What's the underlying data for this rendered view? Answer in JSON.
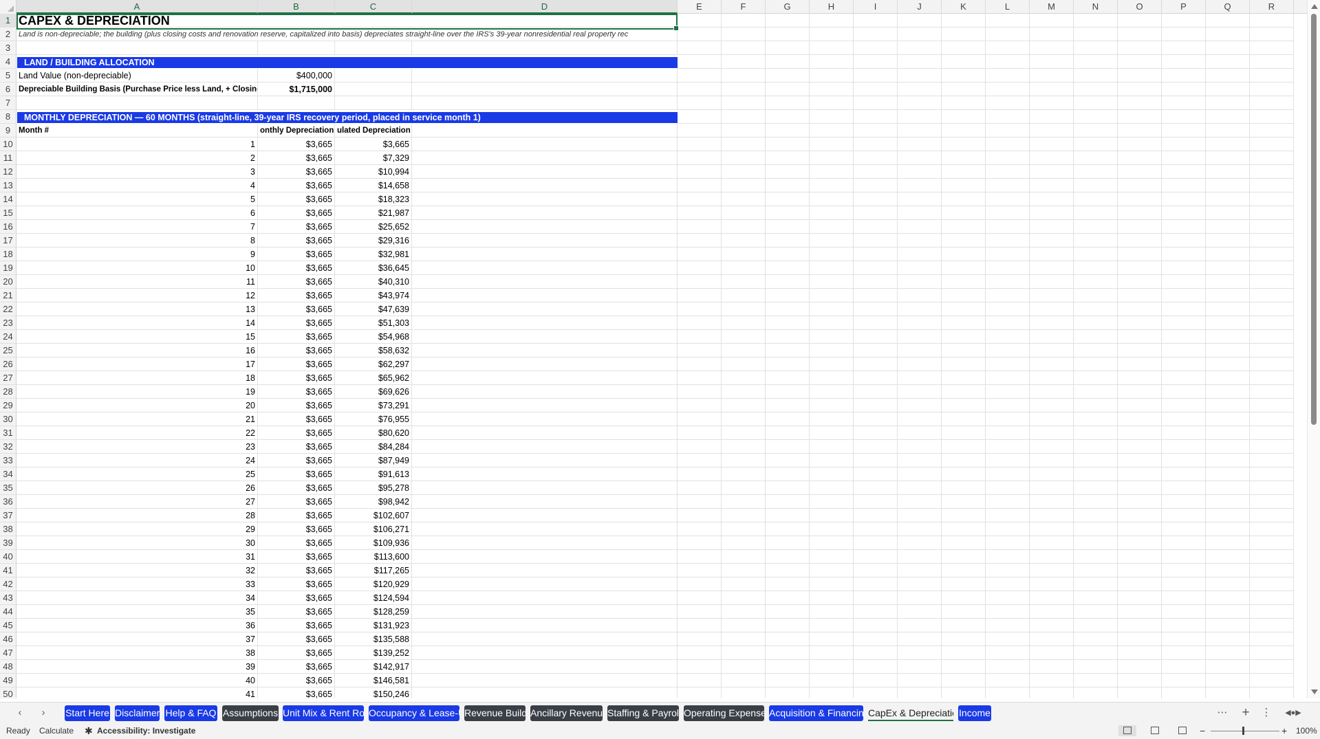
{
  "columns": [
    "A",
    "B",
    "C",
    "D",
    "E",
    "F",
    "G",
    "H",
    "I",
    "J",
    "K",
    "L",
    "M",
    "N",
    "O",
    "P",
    "Q",
    "R"
  ],
  "sheet": {
    "title": "CAPEX & DEPRECIATION",
    "note": "Land is non-depreciable; the building (plus closing costs and renovation reserve, capitalized into basis) depreciates straight-line over the IRS's 39-year nonresidential real property rec",
    "section1": "LAND / BUILDING ALLOCATION",
    "land_label": "Land Value (non-depreciable)",
    "land_value": "$400,000",
    "basis_label": "Depreciable Building Basis (Purchase Price less Land, + Closing Co",
    "basis_value": "$1,715,000",
    "section2": "MONTHLY DEPRECIATION — 60 MONTHS (straight-line, 39-year IRS recovery period, placed in service month 1)",
    "hdr_month": "Month #",
    "hdr_monthly": "onthly Depreciation",
    "hdr_accum": "ulated Depreciation"
  },
  "schedule": [
    {
      "month": "1",
      "monthly": "$3,665",
      "accum": "$3,665"
    },
    {
      "month": "2",
      "monthly": "$3,665",
      "accum": "$7,329"
    },
    {
      "month": "3",
      "monthly": "$3,665",
      "accum": "$10,994"
    },
    {
      "month": "4",
      "monthly": "$3,665",
      "accum": "$14,658"
    },
    {
      "month": "5",
      "monthly": "$3,665",
      "accum": "$18,323"
    },
    {
      "month": "6",
      "monthly": "$3,665",
      "accum": "$21,987"
    },
    {
      "month": "7",
      "monthly": "$3,665",
      "accum": "$25,652"
    },
    {
      "month": "8",
      "monthly": "$3,665",
      "accum": "$29,316"
    },
    {
      "month": "9",
      "monthly": "$3,665",
      "accum": "$32,981"
    },
    {
      "month": "10",
      "monthly": "$3,665",
      "accum": "$36,645"
    },
    {
      "month": "11",
      "monthly": "$3,665",
      "accum": "$40,310"
    },
    {
      "month": "12",
      "monthly": "$3,665",
      "accum": "$43,974"
    },
    {
      "month": "13",
      "monthly": "$3,665",
      "accum": "$47,639"
    },
    {
      "month": "14",
      "monthly": "$3,665",
      "accum": "$51,303"
    },
    {
      "month": "15",
      "monthly": "$3,665",
      "accum": "$54,968"
    },
    {
      "month": "16",
      "monthly": "$3,665",
      "accum": "$58,632"
    },
    {
      "month": "17",
      "monthly": "$3,665",
      "accum": "$62,297"
    },
    {
      "month": "18",
      "monthly": "$3,665",
      "accum": "$65,962"
    },
    {
      "month": "19",
      "monthly": "$3,665",
      "accum": "$69,626"
    },
    {
      "month": "20",
      "monthly": "$3,665",
      "accum": "$73,291"
    },
    {
      "month": "21",
      "monthly": "$3,665",
      "accum": "$76,955"
    },
    {
      "month": "22",
      "monthly": "$3,665",
      "accum": "$80,620"
    },
    {
      "month": "23",
      "monthly": "$3,665",
      "accum": "$84,284"
    },
    {
      "month": "24",
      "monthly": "$3,665",
      "accum": "$87,949"
    },
    {
      "month": "25",
      "monthly": "$3,665",
      "accum": "$91,613"
    },
    {
      "month": "26",
      "monthly": "$3,665",
      "accum": "$95,278"
    },
    {
      "month": "27",
      "monthly": "$3,665",
      "accum": "$98,942"
    },
    {
      "month": "28",
      "monthly": "$3,665",
      "accum": "$102,607"
    },
    {
      "month": "29",
      "monthly": "$3,665",
      "accum": "$106,271"
    },
    {
      "month": "30",
      "monthly": "$3,665",
      "accum": "$109,936"
    },
    {
      "month": "31",
      "monthly": "$3,665",
      "accum": "$113,600"
    },
    {
      "month": "32",
      "monthly": "$3,665",
      "accum": "$117,265"
    },
    {
      "month": "33",
      "monthly": "$3,665",
      "accum": "$120,929"
    },
    {
      "month": "34",
      "monthly": "$3,665",
      "accum": "$124,594"
    },
    {
      "month": "35",
      "monthly": "$3,665",
      "accum": "$128,259"
    },
    {
      "month": "36",
      "monthly": "$3,665",
      "accum": "$131,923"
    },
    {
      "month": "37",
      "monthly": "$3,665",
      "accum": "$135,588"
    },
    {
      "month": "38",
      "monthly": "$3,665",
      "accum": "$139,252"
    },
    {
      "month": "39",
      "monthly": "$3,665",
      "accum": "$142,917"
    },
    {
      "month": "40",
      "monthly": "$3,665",
      "accum": "$146,581"
    },
    {
      "month": "41",
      "monthly": "$3,665",
      "accum": "$150,246"
    }
  ],
  "tabs": [
    {
      "label": "Start Here",
      "style": "blue"
    },
    {
      "label": "Disclaimer",
      "style": "blue"
    },
    {
      "label": "Help & FAQ",
      "style": "blue"
    },
    {
      "label": "Assumptions",
      "style": "dark"
    },
    {
      "label": "Unit Mix & Rent Roll",
      "style": "blue"
    },
    {
      "label": "Occupancy & Lease-Up",
      "style": "blue"
    },
    {
      "label": "Revenue Build",
      "style": "dark"
    },
    {
      "label": "Ancillary Revenue",
      "style": "dark"
    },
    {
      "label": "Staffing & Payroll",
      "style": "dark"
    },
    {
      "label": "Operating Expenses",
      "style": "dark"
    },
    {
      "label": "Acquisition & Financing",
      "style": "blue"
    },
    {
      "label": "CapEx & Depreciation",
      "style": "active"
    },
    {
      "label": "Income",
      "style": "blue"
    }
  ],
  "status": {
    "ready": "Ready",
    "calculate": "Calculate",
    "accessibility": "Accessibility: Investigate",
    "zoom": "100%"
  }
}
